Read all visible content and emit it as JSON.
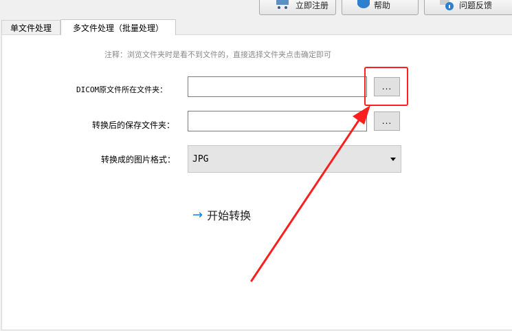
{
  "toolbar": {
    "register_label": "立即注册",
    "help_label": "帮助",
    "feedback_label": "问题反馈"
  },
  "tabs": [
    {
      "label": "单文件处理",
      "active": false
    },
    {
      "label": "多文件处理（批量处理）",
      "active": true
    }
  ],
  "form": {
    "note": "注释：浏览文件夹时是看不到文件的，直接选择文件夹点击确定即可",
    "source_label": "DICOM原文件所在文件夹：",
    "source_value": "",
    "source_browse": "...",
    "output_label": "转换后的保存文件夹：",
    "output_value": "",
    "output_browse": "...",
    "format_label": "转换成的图片格式：",
    "format_value": "JPG",
    "start_label": "开始转换"
  },
  "colors": {
    "annotation": "#ff1e1e",
    "accent": "#1a7fd4"
  }
}
